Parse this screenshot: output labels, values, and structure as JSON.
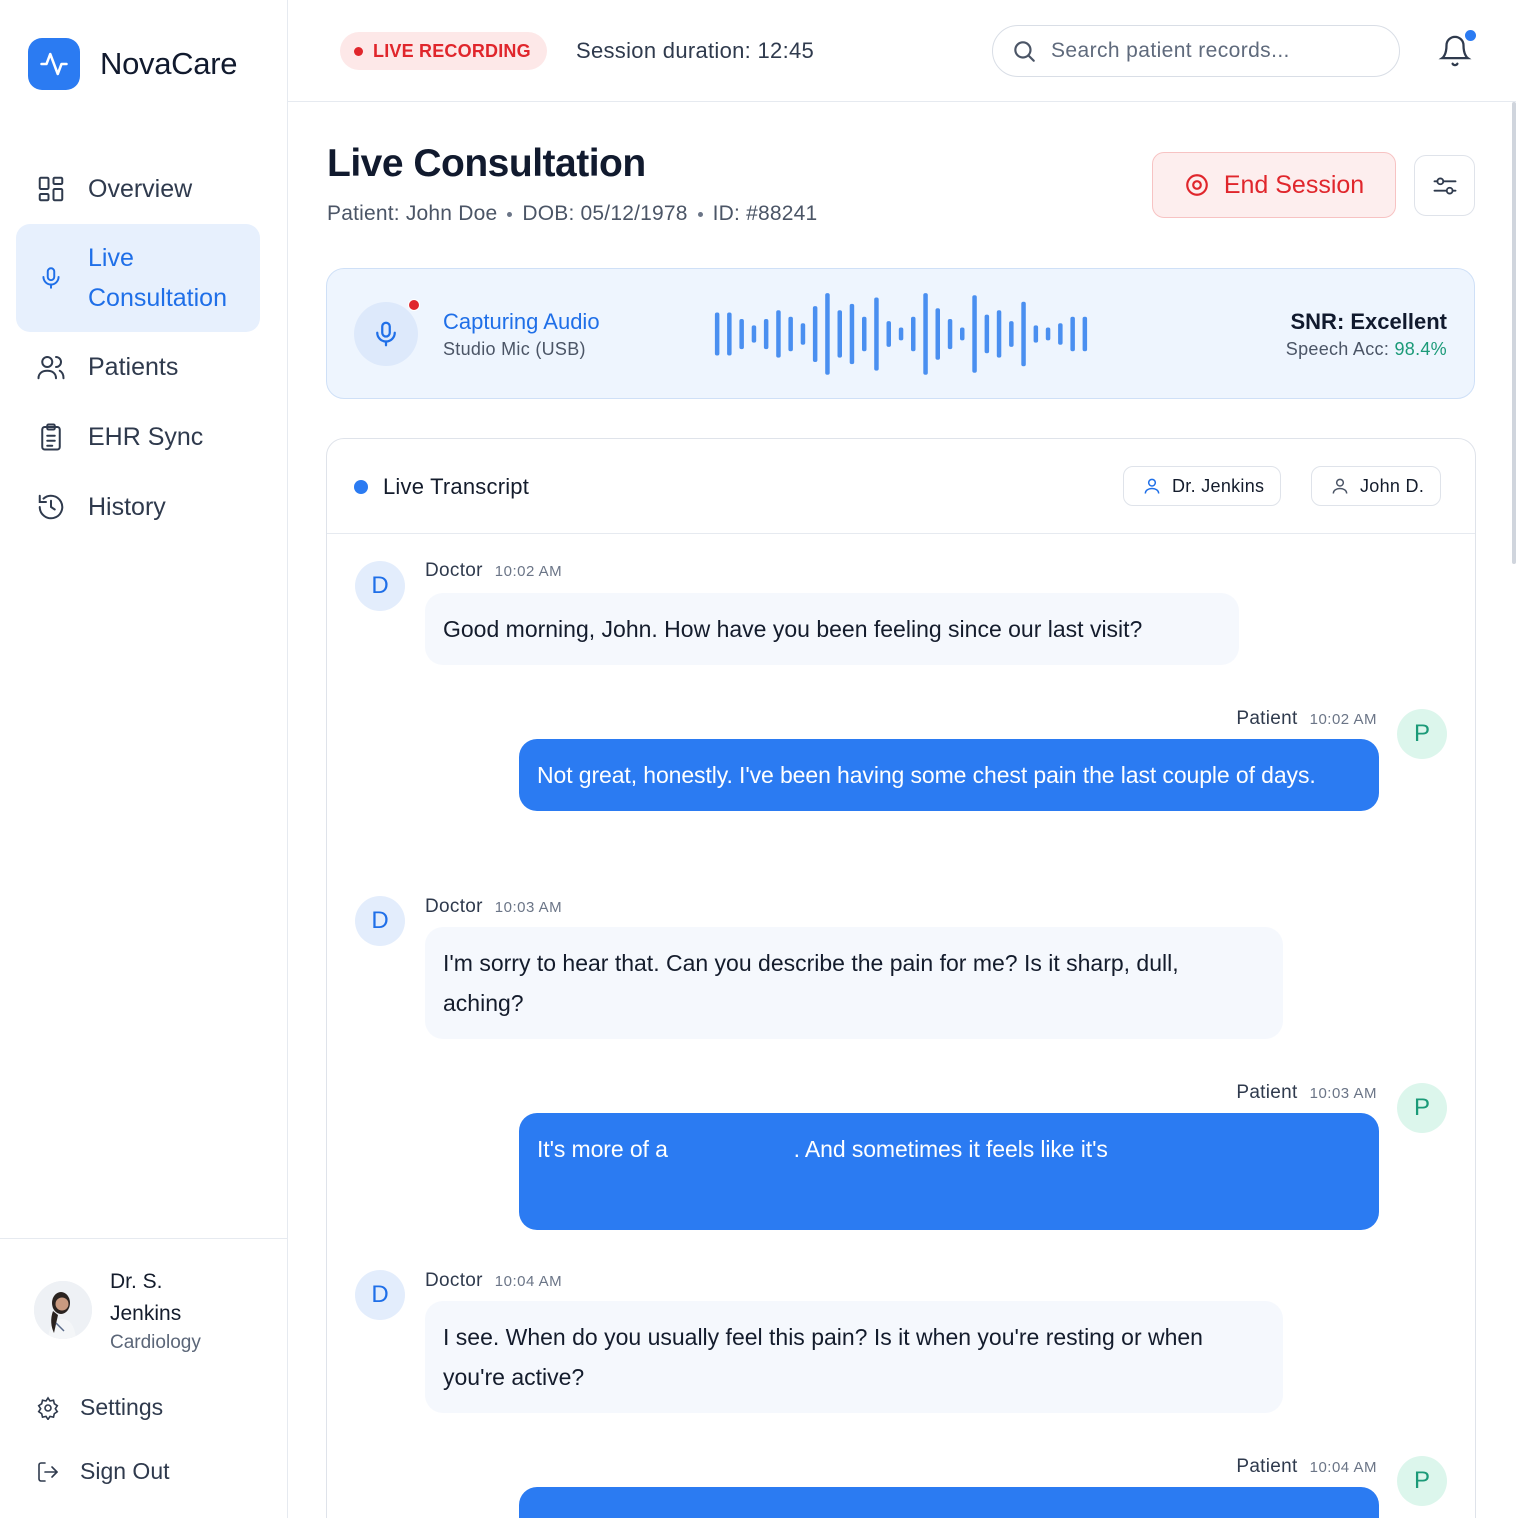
{
  "app": {
    "name": "NovaCare"
  },
  "sidebar": {
    "items": [
      {
        "label": "Overview",
        "icon": "grid-icon"
      },
      {
        "label": "Live Consultation",
        "icon": "mic-icon",
        "active": true
      },
      {
        "label": "Patients",
        "icon": "users-icon"
      },
      {
        "label": "EHR Sync",
        "icon": "clipboard-icon"
      },
      {
        "label": "History",
        "icon": "history-icon"
      }
    ],
    "user": {
      "name": "Dr. S. Jenkins",
      "department": "Cardiology"
    },
    "footer": {
      "settings": "Settings",
      "sign_out": "Sign Out"
    }
  },
  "topbar": {
    "live_badge": "LIVE RECORDING",
    "duration": "Session duration: 12:45",
    "search_placeholder": "Search patient records..."
  },
  "header": {
    "title": "Live Consultation",
    "patient": "Patient: John Doe",
    "dob": "DOB: 05/12/1978",
    "id": "ID: #88241",
    "end_session": "End Session"
  },
  "audio": {
    "title": "Capturing Audio",
    "device": "Studio Mic (USB)",
    "snr": "SNR: Excellent",
    "accuracy_label": "Speech Acc:",
    "accuracy_value": "98.4%",
    "waveform_levels": [
      0.5,
      0.5,
      0.35,
      0.2,
      0.35,
      0.55,
      0.4,
      0.25,
      0.65,
      0.95,
      0.55,
      0.7,
      0.4,
      0.85,
      0.3,
      0.15,
      0.4,
      0.95,
      0.6,
      0.35,
      0.15,
      0.9,
      0.45,
      0.55,
      0.3,
      0.75,
      0.2,
      0.15,
      0.25,
      0.4,
      0.4
    ]
  },
  "transcript": {
    "title": "Live Transcript",
    "speakers": [
      "Dr. Jenkins",
      "John D."
    ],
    "messages": [
      {
        "role": "doctor",
        "initial": "D",
        "speaker": "Doctor",
        "time": "10:02 AM",
        "text": "Good morning, John. How have you been feeling since our last visit?"
      },
      {
        "role": "patient",
        "initial": "P",
        "speaker": "Patient",
        "time": "10:02 AM",
        "text": "Not great, honestly. I've been having some chest pain the last couple of days."
      },
      {
        "role": "doctor",
        "initial": "D",
        "speaker": "Doctor",
        "time": "10:03 AM",
        "text": "I'm sorry to hear that. Can you describe the pain for me? Is it sharp, dull, aching?"
      },
      {
        "role": "patient",
        "initial": "P",
        "speaker": "Patient",
        "time": "10:03 AM",
        "text": "It's more of a                    . And sometimes it feels like it's"
      },
      {
        "role": "doctor",
        "initial": "D",
        "speaker": "Doctor",
        "time": "10:04 AM",
        "text": "I see. When do you usually feel this pain? Is it when you're resting or when you're active?"
      },
      {
        "role": "patient",
        "initial": "P",
        "speaker": "Patient",
        "time": "10:04 AM",
        "text": ""
      }
    ]
  }
}
